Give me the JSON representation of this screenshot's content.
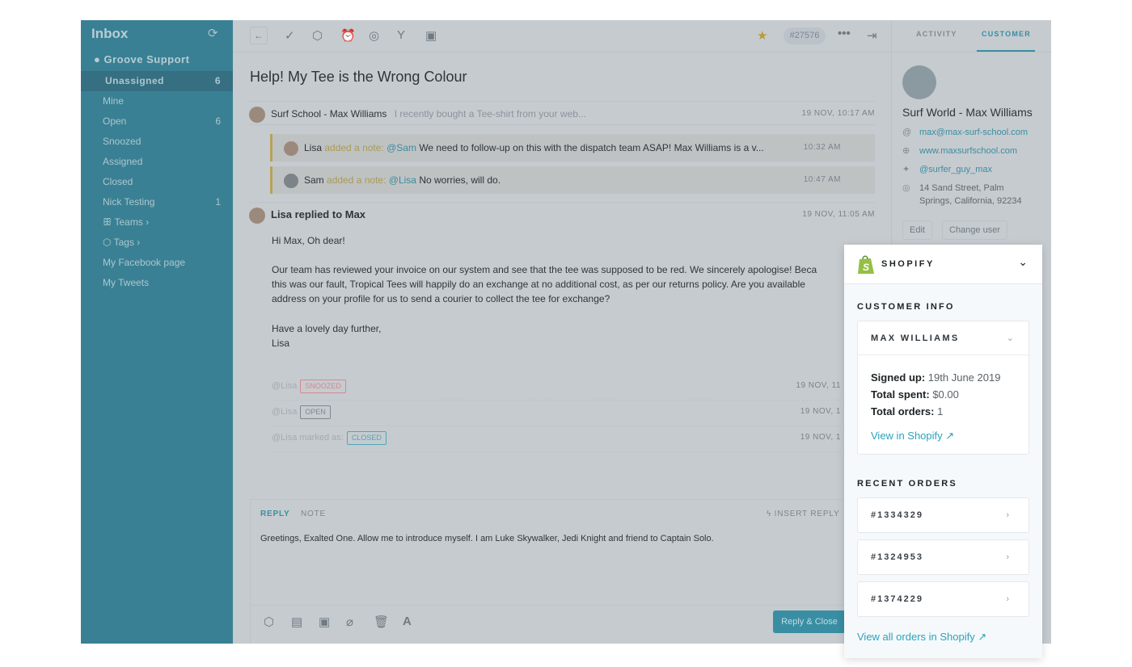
{
  "sidebar": {
    "title": "Inbox",
    "refresh_icon": "refresh-icon",
    "group": "Groove Support",
    "items": [
      {
        "label": "Unassigned",
        "count": "6"
      },
      {
        "label": "Mine",
        "count": ""
      },
      {
        "label": "Open",
        "count": "6"
      },
      {
        "label": "Snoozed",
        "count": ""
      },
      {
        "label": "Assigned",
        "count": ""
      },
      {
        "label": "Closed",
        "count": ""
      },
      {
        "label": "Nick Testing",
        "count": "1"
      },
      {
        "label": "Teams ›",
        "count": ""
      },
      {
        "label": "Tags ›",
        "count": ""
      },
      {
        "label": "My Facebook page",
        "count": ""
      },
      {
        "label": "My Tweets",
        "count": ""
      }
    ]
  },
  "toolbar": {
    "ticket_id": "#27576",
    "icons": [
      "back-icon",
      "check-icon",
      "tag-icon",
      "alarm-icon",
      "target-icon",
      "merge-icon",
      "assign-icon",
      "star-icon",
      "more-icon",
      "exit-icon"
    ]
  },
  "conversation": {
    "subject": "Help! My Tee is the Wrong Colour",
    "first": {
      "author": "Surf School - Max Williams",
      "preview": "I recently bought a Tee-shirt from your web...",
      "time": "19 NOV, 10:17 AM"
    },
    "notes": [
      {
        "author": "Lisa",
        "action": "added a note:",
        "mention": "@Sam",
        "text": "We need to follow-up on this with the dispatch team ASAP! Max Williams is a v...",
        "time": "10:32 AM"
      },
      {
        "author": "Sam",
        "action": "added a note:",
        "mention": "@Lisa",
        "text": "No worries, will do.",
        "time": "10:47 AM"
      }
    ],
    "reply": {
      "title": "Lisa replied to Max",
      "time": "19 NOV, 11:05 AM",
      "greeting": "Hi Max, Oh dear!",
      "para1": "Our team has reviewed your invoice on our system and see that the tee was supposed to be red. We sincerely apologise! Beca",
      "para2": "this was our fault, Tropical Tees will happily do an exchange at no additional cost, as per our returns policy. Are you available",
      "para3": "address on your profile for us to send a courier to collect the tee for exchange?",
      "sign1": "Have a lovely day further,",
      "sign2": "Lisa"
    },
    "statuses": [
      {
        "text": "@Lisa",
        "badge": "SNOOZED",
        "color": "#d38a8f",
        "time": "19 NOV, 11"
      },
      {
        "text": "@Lisa",
        "badge": "OPEN",
        "color": "#8a949b",
        "time": "19 NOV, 1"
      },
      {
        "text": "@Lisa marked as:",
        "badge": "CLOSED",
        "color": "#4fa6b8",
        "time": "19 NOV, 1"
      }
    ]
  },
  "composer": {
    "tab_reply": "REPLY",
    "tab_note": "NOTE",
    "insert_reply": "INSERT REPLY",
    "text": "Greetings, Exalted One. Allow me to introduce myself. I am Luke Skywalker, Jedi Knight and friend to Captain Solo.",
    "send": "Reply & Close"
  },
  "right": {
    "tab_activity": "ACTIVITY",
    "tab_customer": "CUSTOMER",
    "name": "Surf World - Max Williams",
    "email": "max@max-surf-school.com",
    "website": "www.maxsurfschool.com",
    "twitter": "@surfer_guy_max",
    "address1": "14 Sand Street, Palm",
    "address2": "Springs, California, 92234",
    "edit": "Edit",
    "change_user": "Change user"
  },
  "shopify": {
    "title": "SHOPIFY",
    "brand_color": "#95bf47",
    "customer_info": "CUSTOMER INFO",
    "customer_name": "MAX WILLIAMS",
    "signed_up_label": "Signed up:",
    "signed_up": "19th June 2019",
    "spent_label": "Total spent:",
    "spent": "$0.00",
    "orders_label": "Total orders:",
    "orders": "1",
    "view_link": "View in Shopify",
    "recent_orders": "RECENT ORDERS",
    "order_list": [
      "#1334329",
      "#1324953",
      "#1374229"
    ],
    "view_all": "View all orders in Shopify"
  }
}
